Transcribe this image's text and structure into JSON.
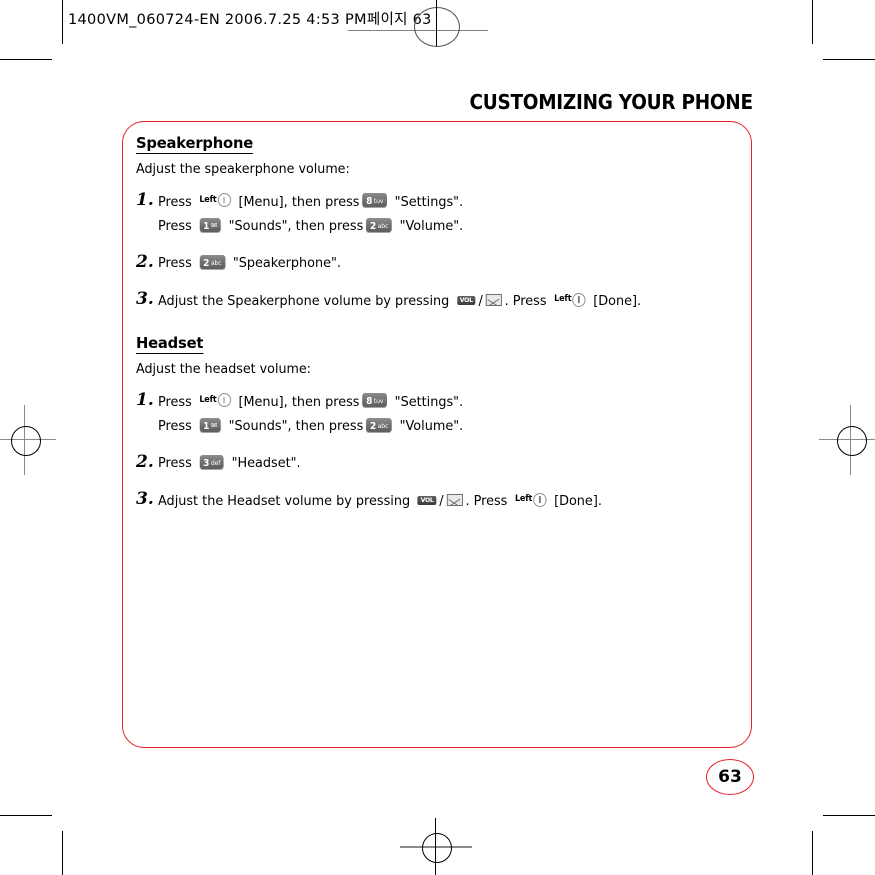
{
  "header": {
    "file_stamp": "1400VM_060724-EN  2006.7.25 4:53 PM",
    "korean_page_label": "페이지 63"
  },
  "page_title": "CUSTOMIZING YOUR PHONE",
  "page_number": "63",
  "colors": {
    "accent_red": "#e8202a",
    "text_black": "#000000",
    "key_gray": "#6e6e6e"
  },
  "sections": [
    {
      "heading": "Speakerphone",
      "subtitle": "Adjust the speakerphone volume:",
      "steps": [
        {
          "number": "1.",
          "line1": {
            "t1": "Press",
            "key1": {
              "type": "softkey",
              "label": "Left"
            },
            "t2": "[Menu], then press",
            "key2": {
              "type": "keycap",
              "num": "8",
              "sub": "tuv"
            },
            "t3": "\"Settings\"."
          },
          "line2": {
            "t1": "Press",
            "key1": {
              "type": "keycap",
              "num": "1",
              "sub": "mail"
            },
            "t2": "\"Sounds\", then press",
            "key2": {
              "type": "keycap",
              "num": "2",
              "sub": "abc"
            },
            "t3": "\"Volume\"."
          }
        },
        {
          "number": "2.",
          "line1": {
            "t1": "Press",
            "key1": {
              "type": "keycap",
              "num": "2",
              "sub": "abc"
            },
            "t2": "\"Speakerphone\"."
          }
        },
        {
          "number": "3.",
          "line1": {
            "t1": "Adjust the Speakerphone volume by pressing",
            "key1": {
              "type": "volkey",
              "label": "VOL"
            },
            "sep": "/",
            "key2": {
              "type": "msgkey",
              "label": "message-envelope"
            },
            "t2": ".  Press",
            "key3": {
              "type": "softkey",
              "label": "Left"
            },
            "t3": "[Done]."
          }
        }
      ]
    },
    {
      "heading": "Headset",
      "subtitle": "Adjust the headset volume:",
      "steps": [
        {
          "number": "1.",
          "line1": {
            "t1": "Press",
            "key1": {
              "type": "softkey",
              "label": "Left"
            },
            "t2": "[Menu], then press",
            "key2": {
              "type": "keycap",
              "num": "8",
              "sub": "tuv"
            },
            "t3": "\"Settings\"."
          },
          "line2": {
            "t1": "Press",
            "key1": {
              "type": "keycap",
              "num": "1",
              "sub": "mail"
            },
            "t2": "\"Sounds\", then press",
            "key2": {
              "type": "keycap",
              "num": "2",
              "sub": "abc"
            },
            "t3": "\"Volume\"."
          }
        },
        {
          "number": "2.",
          "line1": {
            "t1": "Press",
            "key1": {
              "type": "keycap",
              "num": "3",
              "sub": "def"
            },
            "t2": "\"Headset\"."
          }
        },
        {
          "number": "3.",
          "line1": {
            "t1": "Adjust the Headset volume by pressing",
            "key1": {
              "type": "volkey",
              "label": "VOL"
            },
            "sep": "/",
            "key2": {
              "type": "msgkey",
              "label": "message-envelope"
            },
            "t2": ".  Press",
            "key3": {
              "type": "softkey",
              "label": "Left"
            },
            "t3": "[Done]."
          }
        }
      ]
    }
  ]
}
